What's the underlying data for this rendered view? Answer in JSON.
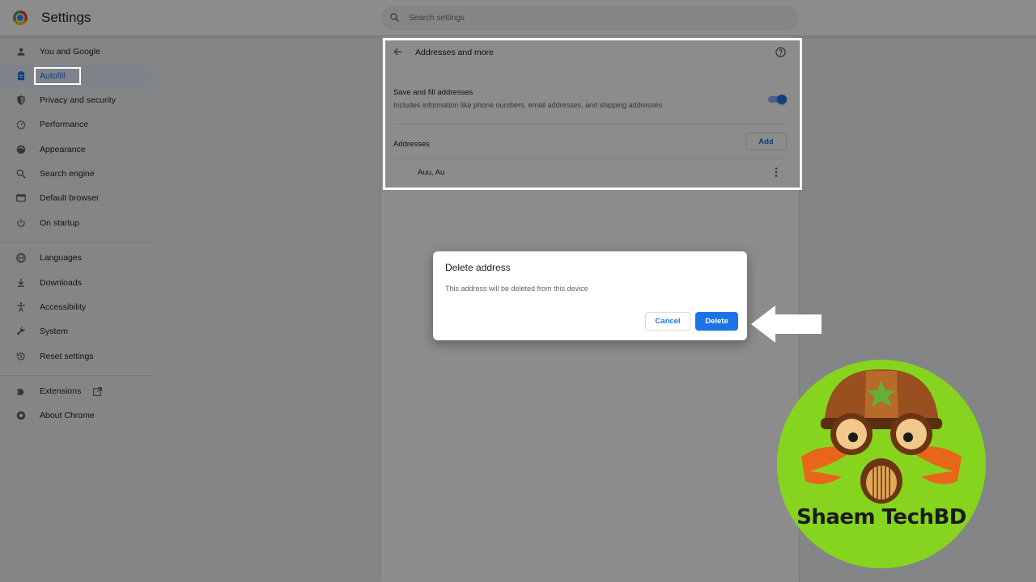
{
  "header": {
    "title": "Settings",
    "search_placeholder": "Search settings"
  },
  "sidebar": {
    "items": [
      {
        "label": "You and Google",
        "icon": "person-icon"
      },
      {
        "label": "Autofill",
        "icon": "clipboard-icon",
        "active": true
      },
      {
        "label": "Privacy and security",
        "icon": "shield-icon"
      },
      {
        "label": "Performance",
        "icon": "gauge-icon"
      },
      {
        "label": "Appearance",
        "icon": "palette-icon"
      },
      {
        "label": "Search engine",
        "icon": "search-icon"
      },
      {
        "label": "Default browser",
        "icon": "browser-icon"
      },
      {
        "label": "On startup",
        "icon": "power-icon"
      },
      {
        "label": "Languages",
        "icon": "globe-icon"
      },
      {
        "label": "Downloads",
        "icon": "download-icon"
      },
      {
        "label": "Accessibility",
        "icon": "accessibility-icon"
      },
      {
        "label": "System",
        "icon": "wrench-icon"
      },
      {
        "label": "Reset settings",
        "icon": "history-icon"
      },
      {
        "label": "Extensions",
        "icon": "puzzle-icon"
      },
      {
        "label": "About Chrome",
        "icon": "chrome-icon"
      }
    ]
  },
  "panel": {
    "title": "Addresses and more",
    "save_fill_title": "Save and fill addresses",
    "save_fill_sub": "Includes information like phone numbers, email addresses, and shipping addresses",
    "toggle_on": true,
    "addresses_title": "Addresses",
    "add_label": "Add",
    "address_entry": "Auu, Au"
  },
  "dialog": {
    "title": "Delete address",
    "body": "This address will be deleted from this device",
    "cancel_label": "Cancel",
    "delete_label": "Delete"
  },
  "watermark": {
    "text": "Shaem TechBD"
  },
  "colors": {
    "accent": "#1a73e8",
    "badge_green": "#86d41e"
  }
}
